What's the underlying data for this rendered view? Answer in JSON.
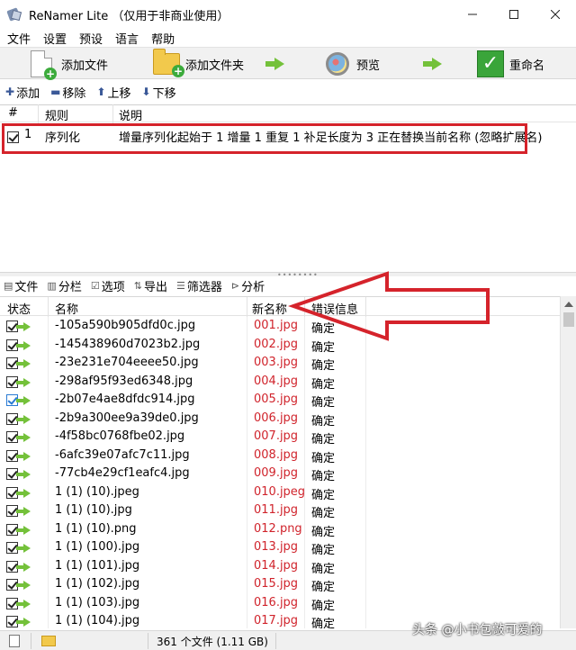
{
  "window": {
    "title": "ReNamer Lite （仅用于非商业使用）",
    "controls": [
      "minimize-icon",
      "maximize-icon",
      "close-icon"
    ]
  },
  "menu": [
    "文件",
    "设置",
    "预设",
    "语言",
    "帮助"
  ],
  "toolbar": {
    "add_files": "添加文件",
    "add_folder": "添加文件夹",
    "preview": "预览",
    "rename": "重命名"
  },
  "rule_toolbar": {
    "add": "添加",
    "remove": "移除",
    "up": "上移",
    "down": "下移"
  },
  "rules_table": {
    "columns": [
      "#",
      "规则",
      "说明"
    ],
    "rows": [
      {
        "checked": true,
        "num": "1",
        "rule": "序列化",
        "desc": "增量序列化起始于 1 增量 1 重复 1 补足长度为 3 正在替换当前名称 (忽略扩展名)"
      }
    ]
  },
  "files_toolbar": [
    "文件",
    "分栏",
    "选项",
    "导出",
    "筛选器",
    "分析"
  ],
  "files_table": {
    "columns": [
      "状态",
      "名称",
      "新名称",
      "错误信息"
    ],
    "rows": [
      {
        "name": "-105a590b905dfd0c.jpg",
        "new": "001.jpg",
        "err": "确定"
      },
      {
        "name": "-145438960d7023b2.jpg",
        "new": "002.jpg",
        "err": "确定"
      },
      {
        "name": "-23e231e704eeee50.jpg",
        "new": "003.jpg",
        "err": "确定"
      },
      {
        "name": "-298af95f93ed6348.jpg",
        "new": "004.jpg",
        "err": "确定"
      },
      {
        "name": "-2b07e4ae8dfdc914.jpg",
        "new": "005.jpg",
        "err": "确定"
      },
      {
        "name": "-2b9a300ee9a39de0.jpg",
        "new": "006.jpg",
        "err": "确定"
      },
      {
        "name": "-4f58bc0768fbe02.jpg",
        "new": "007.jpg",
        "err": "确定"
      },
      {
        "name": "-6afc39e07afc7c11.jpg",
        "new": "008.jpg",
        "err": "确定"
      },
      {
        "name": "-77cb4e29cf1eafc4.jpg",
        "new": "009.jpg",
        "err": "确定"
      },
      {
        "name": "1 (1) (10).jpeg",
        "new": "010.jpeg",
        "err": "确定"
      },
      {
        "name": "1 (1) (10).jpg",
        "new": "011.jpg",
        "err": "确定"
      },
      {
        "name": "1 (1) (10).png",
        "new": "012.png",
        "err": "确定"
      },
      {
        "name": "1 (1) (100).jpg",
        "new": "013.jpg",
        "err": "确定"
      },
      {
        "name": "1 (1) (101).jpg",
        "new": "014.jpg",
        "err": "确定"
      },
      {
        "name": "1 (1) (102).jpg",
        "new": "015.jpg",
        "err": "确定"
      },
      {
        "name": "1 (1) (103).jpg",
        "new": "016.jpg",
        "err": "确定"
      },
      {
        "name": "1 (1) (104).jpg",
        "new": "017.jpg",
        "err": "确定"
      }
    ]
  },
  "status": {
    "file_count": "361 个文件 (1.11 GB)"
  },
  "watermark": "头条 @小书包敲可爱的",
  "colors": {
    "annotation_red": "#d5232b",
    "new_name_red": "#d0232b",
    "arrow_green": "#74c13a"
  }
}
